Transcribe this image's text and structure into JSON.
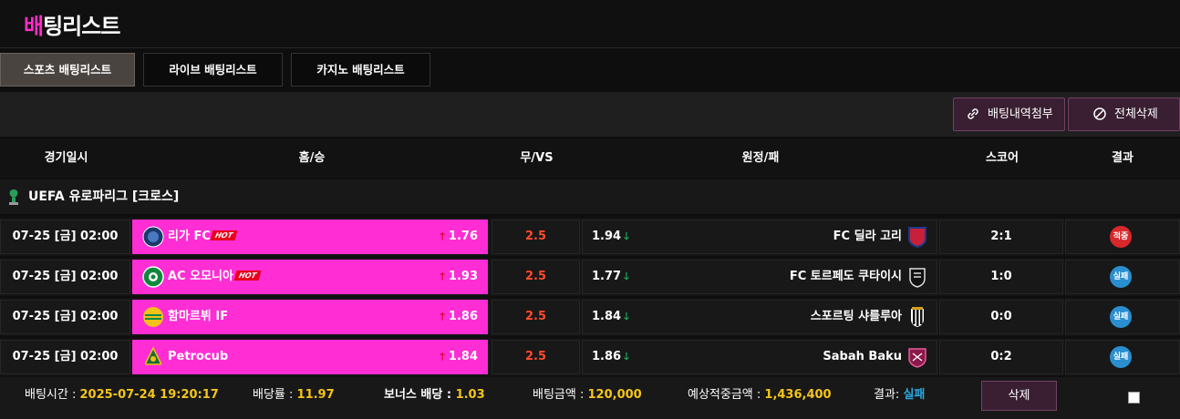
{
  "page": {
    "title_accent": "배",
    "title_rest": "팅리스트"
  },
  "tabs": [
    {
      "label": "스포츠 배팅리스트",
      "active": true
    },
    {
      "label": "라이브 배팅리스트",
      "active": false
    },
    {
      "label": "카지노 배팅리스트",
      "active": false
    }
  ],
  "toolbar": {
    "attach_label": "배팅내역첨부",
    "delete_all_label": "전체삭제"
  },
  "columns": {
    "date": "경기일시",
    "home": "홈/승",
    "draw": "무/VS",
    "away": "원정/패",
    "score": "스코어",
    "result": "결과"
  },
  "league": {
    "name": "UEFA 유로파리그 [크로스]",
    "icon": "uefa-conference-icon"
  },
  "hot_label": "HOT",
  "rows": [
    {
      "date": "07-25 [금] 02:00",
      "home": "리가 FC",
      "home_hot": true,
      "home_odds": "1.76",
      "draw": "2.5",
      "away_odds": "1.94",
      "away": "FC 딜라 고리",
      "score": "2:1",
      "result": "적중",
      "result_type": "win"
    },
    {
      "date": "07-25 [금] 02:00",
      "home": "AC 오모니아",
      "home_hot": true,
      "home_odds": "1.93",
      "draw": "2.5",
      "away_odds": "1.77",
      "away": "FC 토르페도 쿠타이시",
      "score": "1:0",
      "result": "실패",
      "result_type": "lose"
    },
    {
      "date": "07-25 [금] 02:00",
      "home": "함마르뷔 IF",
      "home_hot": false,
      "home_odds": "1.86",
      "draw": "2.5",
      "away_odds": "1.84",
      "away": "스포르팅 샤를루아",
      "score": "0:0",
      "result": "실패",
      "result_type": "lose"
    },
    {
      "date": "07-25 [금] 02:00",
      "home": "Petrocub",
      "home_hot": false,
      "home_odds": "1.84",
      "draw": "2.5",
      "away_odds": "1.86",
      "away": "Sabah Baku",
      "score": "0:2",
      "result": "실패",
      "result_type": "lose"
    }
  ],
  "footer": {
    "bet_time_label": "배팅시간 : ",
    "bet_time": "2025-07-24 19:20:17",
    "rate_label": "배당률 : ",
    "rate": "11.97",
    "bonus_label": "보너스 배당 : ",
    "bonus": "1.03",
    "amount_label": "배팅금액 : ",
    "amount": "120,000",
    "expected_label": "예상적중금액 : ",
    "expected": "1,436,400",
    "result_label": "결과: ",
    "result": "실패",
    "delete_label": "삭제"
  },
  "colors": {
    "accent": "#ff2dd4",
    "win": "#d8282b",
    "lose": "#2a8fd0",
    "value": "#f5c518",
    "draw": "#ff4b2b"
  }
}
